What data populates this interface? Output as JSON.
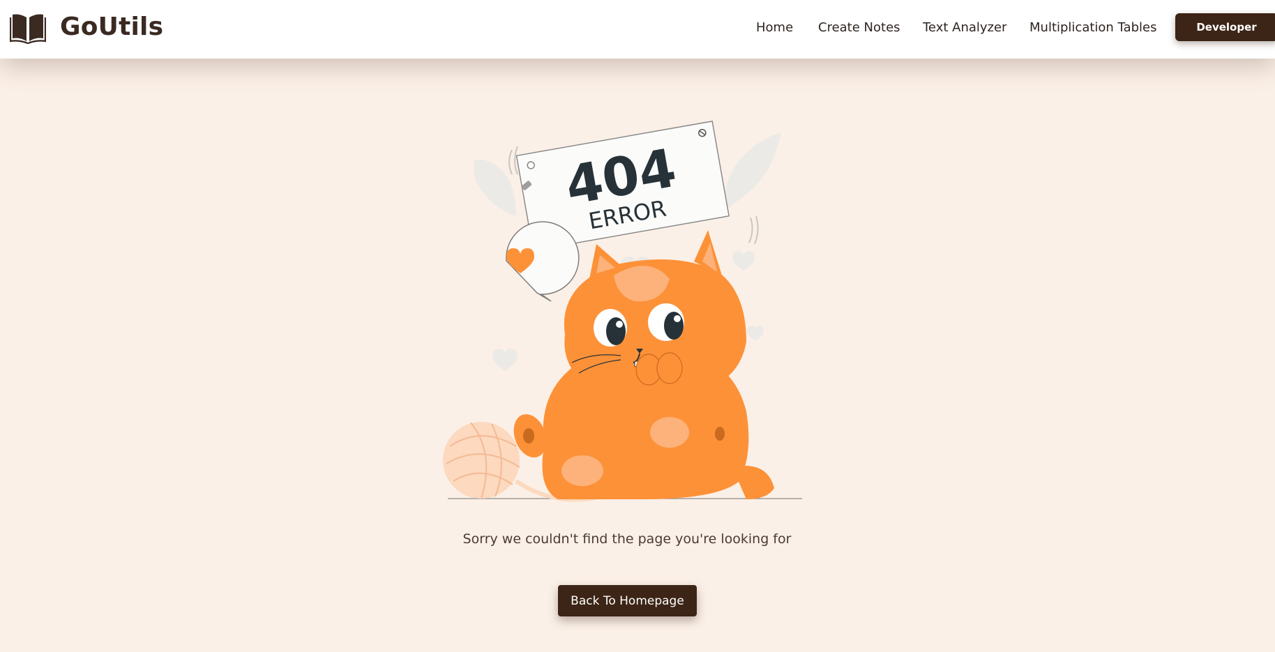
{
  "header": {
    "brand_name": "GoUtils",
    "brand_icon": "open-book-icon",
    "nav": {
      "home": "Home",
      "create_notes": "Create Notes",
      "text_analyzer": "Text Analyzer",
      "multiplication_tables": "Multiplication Tables"
    },
    "developer_button": "Developer"
  },
  "illustration": {
    "code": "404",
    "label": "ERROR",
    "icon": "cat-with-yarn-illustration"
  },
  "main": {
    "message": "Sorry we couldn't find the page you're looking for",
    "back_button": "Back To Homepage"
  },
  "colors": {
    "page_background": "#fbf0e7",
    "button_dark": "#3c2416",
    "cat_orange": "#fd9138"
  }
}
